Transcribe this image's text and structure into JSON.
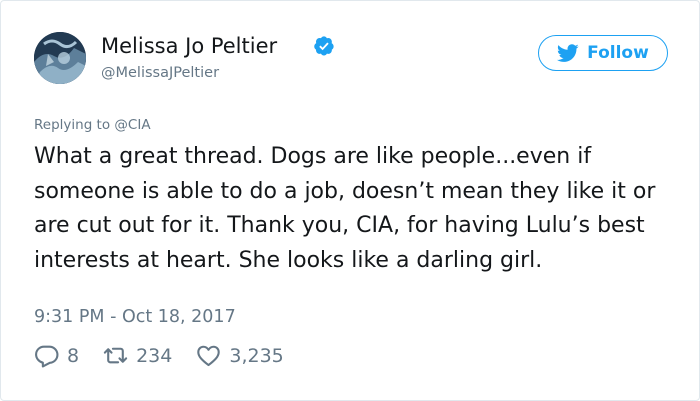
{
  "user": {
    "display_name": "Melissa Jo Peltier",
    "handle": "@MelissaJPeltier",
    "verified": true
  },
  "follow_button": {
    "label": "Follow"
  },
  "reply_context": {
    "prefix": "Replying to ",
    "mention": "@CIA"
  },
  "tweet": {
    "text": "What a great thread. Dogs are like people...even if someone is able to do a job, doesn’t mean they like it or are cut out for it. Thank you, CIA, for having Lulu’s best interests at heart. She looks like a darling girl.",
    "timestamp": "9:31 PM - Oct 18, 2017"
  },
  "stats": {
    "replies": "8",
    "retweets": "234",
    "likes": "3,235"
  },
  "icons": {
    "verified": "verified-badge-icon",
    "twitter": "twitter-bird-icon",
    "reply": "reply-icon",
    "retweet": "retweet-icon",
    "like": "heart-icon"
  },
  "colors": {
    "brand": "#1da1f2",
    "text": "#14171a",
    "muted": "#657786",
    "border": "#e1e8ed"
  }
}
